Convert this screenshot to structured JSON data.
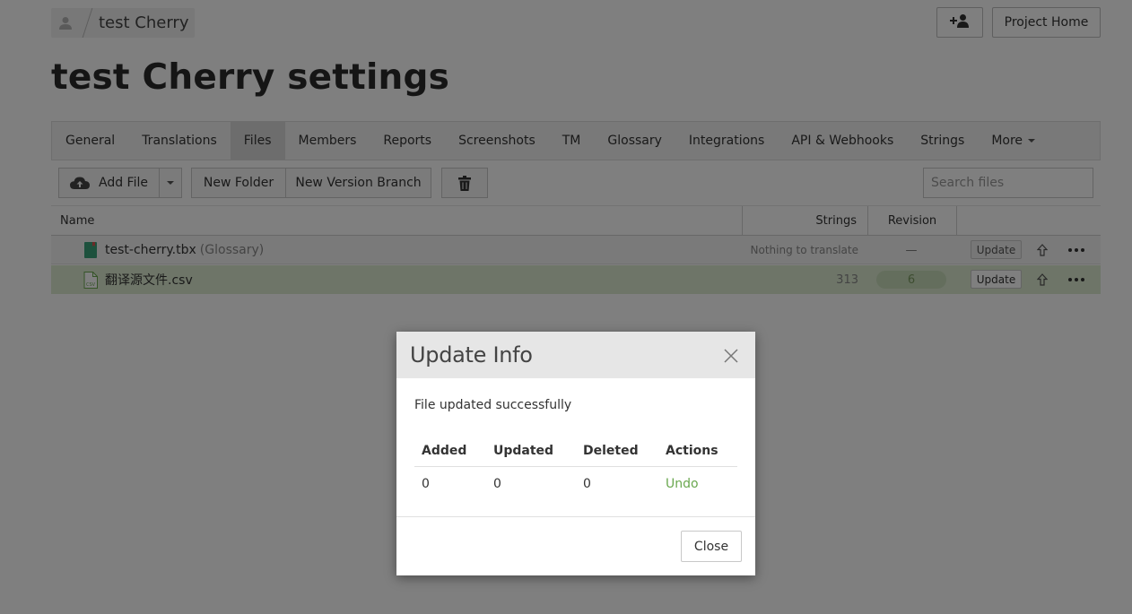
{
  "breadcrumb": {
    "project": "test Cherry"
  },
  "header": {
    "project_home": "Project Home",
    "page_title": "test Cherry settings"
  },
  "tabs": [
    {
      "label": "General"
    },
    {
      "label": "Translations"
    },
    {
      "label": "Files",
      "active": true
    },
    {
      "label": "Members"
    },
    {
      "label": "Reports"
    },
    {
      "label": "Screenshots"
    },
    {
      "label": "TM"
    },
    {
      "label": "Glossary"
    },
    {
      "label": "Integrations"
    },
    {
      "label": "API & Webhooks"
    },
    {
      "label": "Strings"
    },
    {
      "label": "More"
    }
  ],
  "toolbar": {
    "add_file": "Add File",
    "new_folder": "New Folder",
    "new_version_branch": "New Version Branch",
    "search_placeholder": "Search files"
  },
  "table": {
    "headers": {
      "name": "Name",
      "strings": "Strings",
      "revision": "Revision"
    },
    "rows": [
      {
        "name": "test-cherry.tbx",
        "suffix": "(Glossary)",
        "strings": "Nothing to translate",
        "revision": "—",
        "update": "Update"
      },
      {
        "name": "翻译源文件.csv",
        "suffix": "",
        "strings": "313",
        "revision": "6",
        "update": "Update"
      }
    ]
  },
  "modal": {
    "title": "Update Info",
    "message": "File updated successfully",
    "columns": [
      "Added",
      "Updated",
      "Deleted",
      "Actions"
    ],
    "values": {
      "added": "0",
      "updated": "0",
      "deleted": "0",
      "action": "Undo"
    },
    "close": "Close"
  },
  "colors": {
    "accent_green": "#6aa84f",
    "selected_row": "#dcebd0"
  }
}
